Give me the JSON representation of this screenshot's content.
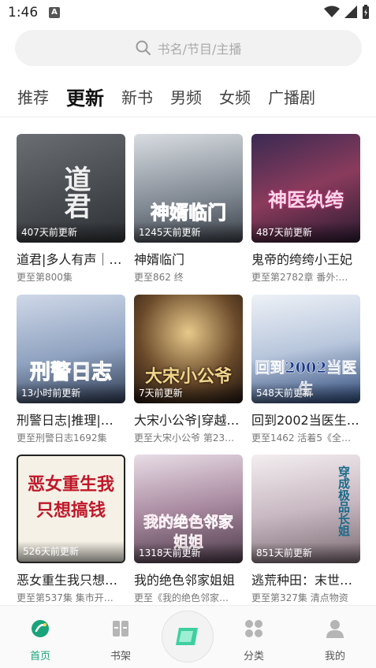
{
  "status_bar": {
    "time": "1:46",
    "notification_letter": "A"
  },
  "search": {
    "placeholder": "书名/节目/主播"
  },
  "tabs": [
    {
      "label": "推荐"
    },
    {
      "label": "更新"
    },
    {
      "label": "新书"
    },
    {
      "label": "男频"
    },
    {
      "label": "女频"
    },
    {
      "label": "广播剧"
    }
  ],
  "books": [
    {
      "badge": "407天前更新",
      "title": "道君|多人有声｜…",
      "subtitle": "更至第800集",
      "cover_text": "道君"
    },
    {
      "badge": "1245天前更新",
      "title": "神婿临门",
      "subtitle": "更至862 终",
      "cover_text": "神婿临门"
    },
    {
      "badge": "487天前更新",
      "title": "鬼帝的绔绔小王妃",
      "subtitle": "更至第2782章 番外:…",
      "cover_text": "神医纨绔"
    },
    {
      "badge": "13小时前更新",
      "title": "刑警日志|推理|…",
      "subtitle": "更至刑警日志1692集",
      "cover_text": "刑警日志"
    },
    {
      "badge": "7天前更新",
      "title": "大宋小公爷|穿越…",
      "subtitle": "更至大宋小公爷 第23…",
      "cover_text": "大宋小公爷"
    },
    {
      "badge": "548天前更新",
      "title": "回到2002当医生…",
      "subtitle": "更至1462 活着5《全…",
      "cover_text": "回到2002当医生"
    },
    {
      "badge": "526天前更新",
      "title": "恶女重生我只想…",
      "subtitle": "更至第537集 集市开…",
      "cover_text": "恶女重生我只想搞钱"
    },
    {
      "badge": "1318天前更新",
      "title": "我的绝色邻家姐姐",
      "subtitle": "更至《我的绝色邻家…",
      "cover_text": "我的绝色邻家姐姐"
    },
    {
      "badge": "851天前更新",
      "title": "逃荒种田：末世…",
      "subtitle": "更至第327集 清点物资",
      "cover_text": "穿成极品长姐"
    }
  ],
  "bottom_nav": [
    {
      "label": "首页",
      "icon": "home-icon"
    },
    {
      "label": "书架",
      "icon": "bookshelf-icon"
    },
    {
      "label": "分类",
      "icon": "category-icon"
    },
    {
      "label": "我的",
      "icon": "profile-icon"
    }
  ],
  "colors": {
    "accent": "#1aa37a"
  }
}
